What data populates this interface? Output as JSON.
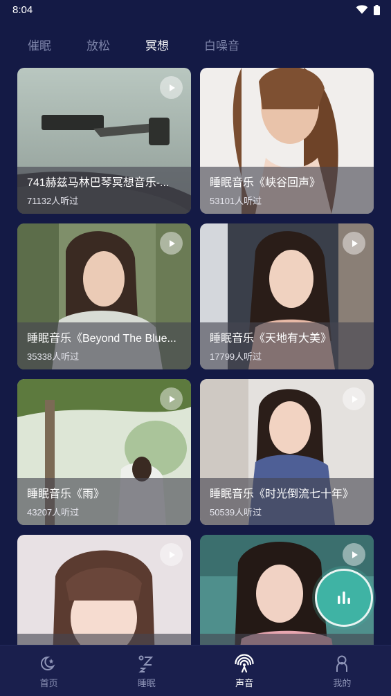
{
  "status_bar": {
    "time": "8:04"
  },
  "tabs": [
    {
      "label": "催眠"
    },
    {
      "label": "放松"
    },
    {
      "label": "冥想"
    },
    {
      "label": "白噪音"
    }
  ],
  "cards": [
    {
      "title": "741赫兹马林巴琴冥想音乐-...",
      "listens": "71132人听过"
    },
    {
      "title": "睡眠音乐《峡谷回声》",
      "listens": "53101人听过"
    },
    {
      "title": "睡眠音乐《Beyond The Blue...",
      "listens": "35338人听过"
    },
    {
      "title": "睡眠音乐《天地有大美》",
      "listens": "17799人听过"
    },
    {
      "title": "睡眠音乐《雨》",
      "listens": "43207人听过"
    },
    {
      "title": "睡眠音乐《时光倒流七十年》",
      "listens": "50539人听过"
    },
    {
      "title": "",
      "listens": ""
    },
    {
      "title": "",
      "listens": ""
    }
  ],
  "bottom_nav": [
    {
      "label": "首页",
      "icon": "moon-star-icon"
    },
    {
      "label": "睡眠",
      "icon": "sleep-z-icon"
    },
    {
      "label": "声音",
      "icon": "sound-wave-icon"
    },
    {
      "label": "我的",
      "icon": "person-icon"
    }
  ],
  "colors": {
    "background": "#141a45",
    "nav_background": "#1a1f4d",
    "tab_inactive": "#7c83a8",
    "accent_teal": "#3fb3a4"
  }
}
